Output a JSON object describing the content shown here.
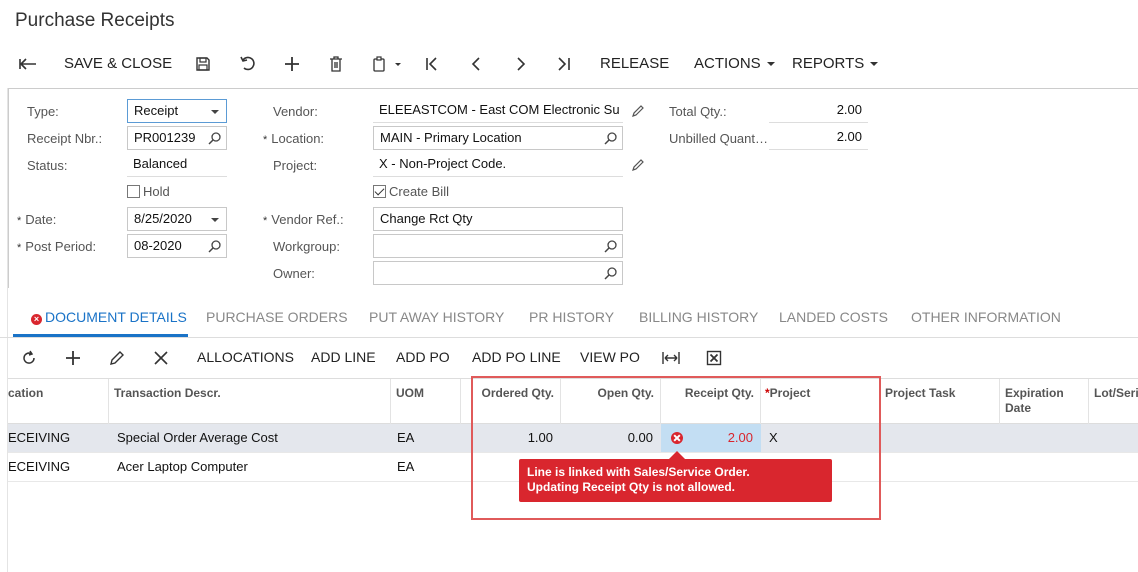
{
  "page": {
    "title": "Purchase Receipts"
  },
  "toolbar": {
    "save_close": "SAVE & CLOSE",
    "release": "RELEASE",
    "actions": "ACTIONS",
    "reports": "REPORTS"
  },
  "form": {
    "type_label": "Type:",
    "type_value": "Receipt",
    "receipt_nbr_label": "Receipt Nbr.:",
    "receipt_nbr_value": "PR001239",
    "status_label": "Status:",
    "status_value": "Balanced",
    "hold_label": "Hold",
    "date_label": "Date:",
    "date_value": "8/25/2020",
    "post_period_label": "Post Period:",
    "post_period_value": "08-2020",
    "vendor_label": "Vendor:",
    "vendor_value": "ELEEASTCOM - East COM Electronic Su",
    "location_label": "Location:",
    "location_value": "MAIN - Primary Location",
    "project_label": "Project:",
    "project_value": "X - Non-Project Code.",
    "create_bill_label": "Create Bill",
    "vendor_ref_label": "Vendor Ref.:",
    "vendor_ref_value": "Change Rct Qty",
    "workgroup_label": "Workgroup:",
    "workgroup_value": "",
    "owner_label": "Owner:",
    "owner_value": "",
    "total_qty_label": "Total Qty.:",
    "total_qty_value": "2.00",
    "unbilled_qty_label": "Unbilled Quant…",
    "unbilled_qty_value": "2.00",
    "required_mark": "*",
    "hold_checked": false,
    "create_bill_checked": true
  },
  "tabs": [
    {
      "label": "DOCUMENT DETAILS",
      "active": true
    },
    {
      "label": "PURCHASE ORDERS"
    },
    {
      "label": "PUT AWAY HISTORY"
    },
    {
      "label": "PR HISTORY"
    },
    {
      "label": "BILLING HISTORY"
    },
    {
      "label": "LANDED COSTS"
    },
    {
      "label": "OTHER INFORMATION"
    }
  ],
  "grid_toolbar": {
    "allocations": "ALLOCATIONS",
    "add_line": "ADD LINE",
    "add_po": "ADD PO",
    "add_po_line": "ADD PO LINE",
    "view_po": "VIEW PO"
  },
  "grid": {
    "columns": {
      "location": "cation",
      "descr": "Transaction Descr.",
      "uom": "UOM",
      "ordered": "Ordered Qty.",
      "open": "Open Qty.",
      "receipt": "Receipt Qty.",
      "project": "Project",
      "project_task": "Project Task",
      "expiration": "Expiration Date",
      "lot": "Lot/Seri"
    },
    "rows": [
      {
        "location": "ECEIVING",
        "descr": "Special Order Average Cost",
        "uom": "EA",
        "ordered": "1.00",
        "open": "0.00",
        "receipt": "2.00",
        "project": "X"
      },
      {
        "location": "ECEIVING",
        "descr": "Acer Laptop Computer",
        "uom": "EA",
        "ordered": "",
        "open": "",
        "receipt": "",
        "project": ""
      }
    ]
  },
  "error": {
    "line1": "Line is linked with Sales/Service Order.",
    "line2": "Updating Receipt Qty is not allowed."
  },
  "colors": {
    "accent": "#1a73c7",
    "error": "#d9262e",
    "highlight_box": "#e05a5a"
  }
}
